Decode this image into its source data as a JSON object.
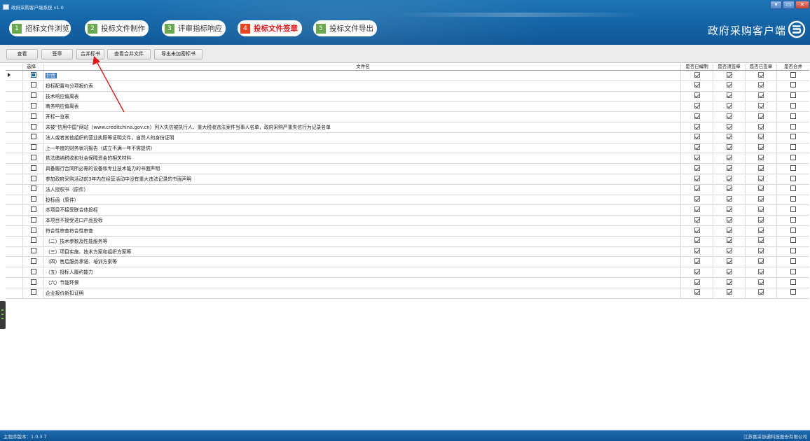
{
  "window": {
    "title": "政府采购客户端系统 v1.0",
    "min_glyph": "▾",
    "max_glyph": "▭",
    "close_glyph": "✕"
  },
  "steps": [
    {
      "num": "1",
      "label": "招标文件浏览",
      "active": false
    },
    {
      "num": "2",
      "label": "投标文件制作",
      "active": false
    },
    {
      "num": "3",
      "label": "评审指标响应",
      "active": false
    },
    {
      "num": "4",
      "label": "投标文件签章",
      "active": true
    },
    {
      "num": "5",
      "label": "投标文件导出",
      "active": false
    }
  ],
  "brand": {
    "text": "政府采购客户端"
  },
  "toolbar": {
    "view": "查看",
    "sign": "签章",
    "merge": "合并标书",
    "view_merged": "查看合并文件",
    "export_unencrypted": "导出未加密标书"
  },
  "grid": {
    "columns": {
      "select": "选择",
      "name": "文件名",
      "compiled": "是否已编制",
      "needs_sign": "是否须签章",
      "signed": "是否已签章",
      "merged": "是否合并"
    },
    "rows": [
      {
        "name": "封面",
        "selected": true
      },
      {
        "name": "投标配置与分项报价表"
      },
      {
        "name": "技术响应偏离表"
      },
      {
        "name": "商务响应偏离表"
      },
      {
        "name": "开标一览表"
      },
      {
        "name": "未被“信用中国”网站（www.creditchina.gov.cn）列入失信被执行人、重大税收违法案件当事人名单，政府采购严重失信行为记录名单"
      },
      {
        "name": "法人或者其他组织的营业执照等证明文件，自然人的身份证明"
      },
      {
        "name": "上一年度的财务状况报告（成立不满一年不需提供）"
      },
      {
        "name": "依法缴纳税收和社会保障资金的相关材料"
      },
      {
        "name": "具备履行合同所必需的设备和专业技术能力的书面声明"
      },
      {
        "name": "参加政府采购活动前3年内在经营活动中没有重大违法记录的书面声明"
      },
      {
        "name": "法人授权书（原件）"
      },
      {
        "name": "投标函（原件）"
      },
      {
        "name": "本项目不接受联合体投标"
      },
      {
        "name": "本项目不接受进口产品投标"
      },
      {
        "name": "符合性审查符合性审查"
      },
      {
        "name": "（二）技术参数及性能服务等"
      },
      {
        "name": "（三）项目实施、技术方案和组织方案等"
      },
      {
        "name": "（四）售后服务承诺、培训方案等"
      },
      {
        "name": "（五）投标人履约能力"
      },
      {
        "name": "（六）节能环保"
      },
      {
        "name": "企业报价新扣证明"
      }
    ]
  },
  "status": {
    "version": "主程序版本：1.0.3.7",
    "company": "江苏富采协通科技股份有限公司"
  },
  "colors": {
    "header_blue": "#1566a8",
    "step_green": "#6aa84f",
    "step_active_red": "#e8431f",
    "annotation_red": "#e01818"
  }
}
